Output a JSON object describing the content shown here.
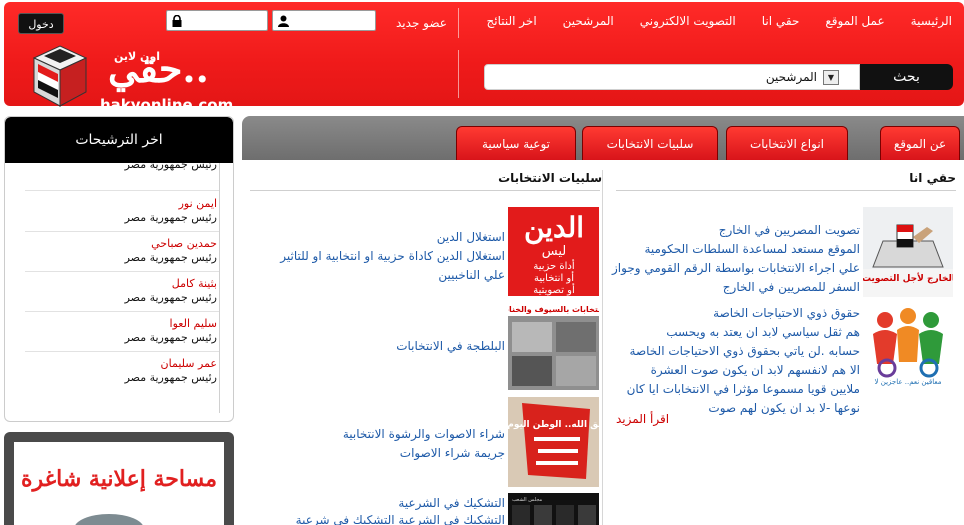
{
  "header": {
    "nav": [
      "الرئيسية",
      "عمل الموقع",
      "حقي انا",
      "التصويت الالكتروني",
      "المرشحين",
      "اخر النتائج"
    ],
    "new_member": "عضو جديد",
    "login_button": "دخول",
    "logo_text": "حقي..",
    "logo_subtext": "اون لاين",
    "logo_url": "hakyonline.com",
    "search_select_value": "المرشحين",
    "search_button": "بحث"
  },
  "sidebar": {
    "title": "اخر الترشيحات",
    "candidates": [
      {
        "name": "",
        "role": "رئيس جمهورية مصر"
      },
      {
        "name": "ايمن نور",
        "role": "رئيس جمهورية مصر"
      },
      {
        "name": "حمدين صباحي",
        "role": "رئيس جمهورية مصر"
      },
      {
        "name": "بثينة كامل",
        "role": "رئيس جمهورية مصر"
      },
      {
        "name": "سليم العوا",
        "role": "رئيس جمهورية مصر"
      },
      {
        "name": "عمر سليمان",
        "role": "رئيس جمهورية مصر"
      }
    ],
    "ad_text": "مساحة إعلانية شاغرة"
  },
  "tabs": [
    "عن الموقع",
    "انواع الانتخابات",
    "سلبيات الانتخابات",
    "توعية سياسية"
  ],
  "right_column": {
    "title": "حقي انا",
    "items": [
      {
        "title": "تصويت المصريين في الخارج",
        "desc_lines": [
          "الموقع مستعد لمساعدة السلطات الحكومية",
          "علي اجراء الانتخابات بواسطة الرقم القومي وجواز",
          "السفر للمصريين في الخارج"
        ],
        "thumb_caption": "مصريون بالخارج لأجل التصويت والانتخاب"
      },
      {
        "title": "حقوق ذوي الاحتياجات الخاصة",
        "desc_lines": [
          "هم ثقل سياسي لابد ان يعتد به ويحسب",
          "حسابه .لن ياتي بحقوق ذوي الاحتياجات الخاصة",
          "الا هم لانفسهم لابد ان يكون صوت العشرة",
          "ملايين قويا مسموعا مؤثرا في الانتخابات ايا كان",
          "نوعها -لا بد ان يكون لهم صوت"
        ],
        "thumb_caption": "معاقين نعم.. عاجزين لا"
      }
    ],
    "read_more": "اقرأ المزيد"
  },
  "middle_column": {
    "title": "سلبيات الانتخابات",
    "items": [
      {
        "title": "استغلال الدين",
        "desc_lines": [
          "استغلال الدين كاداة حزبية او انتخابية او للتاثير",
          "علي الناخبيين"
        ],
        "thumb_caption": [
          "الدين",
          "ليس",
          "أداة حزبية",
          "أو انتخابية",
          "أو تصويتية"
        ]
      },
      {
        "title": "البلطجة في الانتخابات",
        "desc_lines": [],
        "thumb_caption": "الانتخابات بالسيوف والخناجر"
      },
      {
        "title": "شراء الاصوات والرشوة الانتخابية",
        "desc_lines": [
          "جريمة شراء الاصوات"
        ],
        "thumb_caption": "اتق الله.. الوطن اليوم"
      },
      {
        "title": "التشكيك في الشرعية",
        "desc_lines": [
          "التشكيك في الشرعية التشكيك في شرعية"
        ],
        "thumb_caption": "مجلس الشعب"
      }
    ]
  }
}
